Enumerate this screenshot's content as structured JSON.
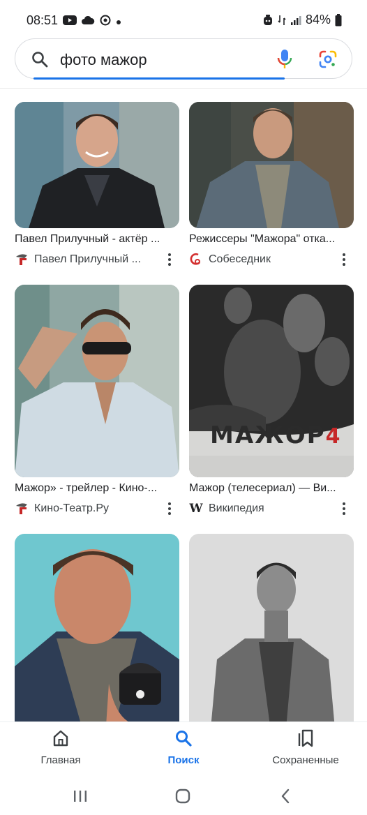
{
  "status_bar": {
    "time": "08:51",
    "battery": "84%"
  },
  "search": {
    "query": "фото мажор"
  },
  "results": [
    {
      "title": "Павел Прилучный - актёр ...",
      "source": "Павел Прилучный ...",
      "source_icon": "kino-teatr-icon"
    },
    {
      "title": "Режиссеры \"Мажора\" отка...",
      "source": "Собеседник",
      "source_icon": "sobesednik-icon"
    },
    {
      "title": "Мажор» - трейлер - Кино-...",
      "source": "Кино-Театр.Ру",
      "source_icon": "kino-teatr-icon"
    },
    {
      "title": "Мажор (телесериал) — Ви...",
      "source": "Википедия",
      "source_icon": "wikipedia-icon",
      "poster_text": "МАЖОР",
      "poster_number": "4"
    },
    {
      "title": "",
      "source": "",
      "source_icon": ""
    },
    {
      "title": "",
      "source": "",
      "source_icon": ""
    }
  ],
  "bottom_nav": {
    "home_label": "Главная",
    "search_label": "Поиск",
    "saved_label": "Сохраненные",
    "active": "search"
  },
  "colors": {
    "accent": "#1a73e8",
    "text": "#202124",
    "muted": "#3c4043"
  }
}
